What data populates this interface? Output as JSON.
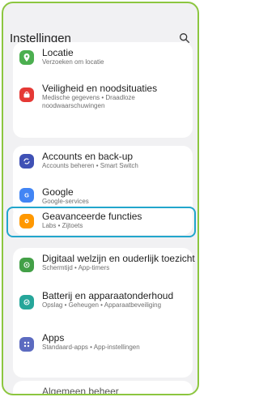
{
  "header": {
    "title": "Instellingen"
  },
  "colors": {
    "frame_border": "#8cc63f",
    "highlight_border": "#22a6cc",
    "background": "#f1f1f3"
  },
  "items": [
    {
      "label": "Locatie",
      "sub": "Verzoeken om locatie",
      "icon": "location-pin-icon",
      "color": "#4caf50"
    },
    {
      "label": "Veiligheid en noodsituaties",
      "sub": "Medische gegevens  •  Draadloze noodwaarschuwingen",
      "icon": "emergency-icon",
      "color": "#e53935"
    },
    {
      "label": "Accounts en back-up",
      "sub": "Accounts beheren  •  Smart Switch",
      "icon": "sync-icon",
      "color": "#3f51b5"
    },
    {
      "label": "Google",
      "sub": "Google-services",
      "icon": "google-icon",
      "color": "#4285f4"
    },
    {
      "label": "Geavanceerde functies",
      "sub": "Labs  •  Zijtoets",
      "icon": "gear-plus-icon",
      "color": "#ff9800"
    },
    {
      "label": "Digitaal welzijn en ouderlijk toezicht",
      "sub": "Schermtijd  •  App-timers",
      "icon": "wellbeing-icon",
      "color": "#43a047"
    },
    {
      "label": "Batterij en apparaatonderhoud",
      "sub": "Opslag  •  Geheugen  •  Apparaatbeveiliging",
      "icon": "device-care-icon",
      "color": "#26a69a"
    },
    {
      "label": "Apps",
      "sub": "Standaard-apps  •  App-instellingen",
      "icon": "apps-grid-icon",
      "color": "#5c6bc0"
    }
  ],
  "partial_item": {
    "label": "Algemeen beheer"
  }
}
